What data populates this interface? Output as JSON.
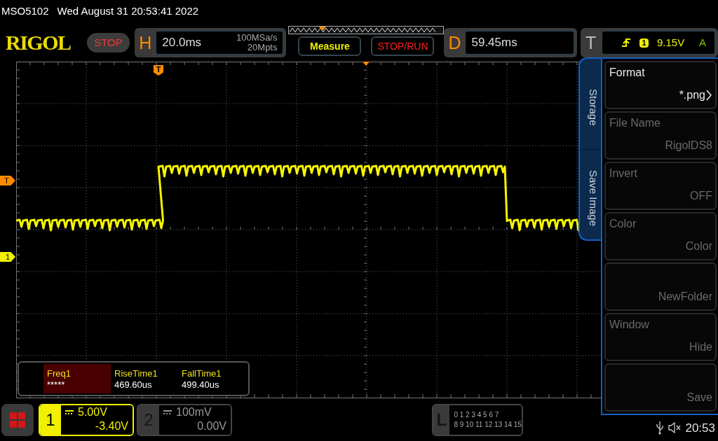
{
  "title_bar": {
    "model": "MSO5102",
    "datetime": "Wed August 31 20:53:41 2022"
  },
  "logo": "RIGOL",
  "run_state": "STOP",
  "horizontal": {
    "label": "H",
    "timebase": "20.0ms",
    "sample_rate": "100MSa/s",
    "memory_depth": "20Mpts"
  },
  "buttons": [
    {
      "label": "Measure",
      "kind": "measure"
    },
    {
      "label": "STOP/RUN",
      "kind": "run"
    }
  ],
  "delay": {
    "label": "D",
    "value": "59.45ms"
  },
  "trigger": {
    "label": "T",
    "source": "1",
    "threshold": "9.15V",
    "mode": "A"
  },
  "grid_markers": {
    "trigger_position": "T",
    "trigger_level": "T",
    "channel": "1"
  },
  "measurements": [
    {
      "name": "Freq1",
      "value": "*****",
      "selected": true
    },
    {
      "name": "RiseTime1",
      "value": "469.60us",
      "selected": false
    },
    {
      "name": "FallTime1",
      "value": "499.40us",
      "selected": false
    }
  ],
  "side_menu": {
    "tabs": [
      "Storage",
      "Save Image"
    ],
    "items": [
      {
        "label": "Format",
        "value": "*.png",
        "disabled": false,
        "submenu": true
      },
      {
        "label": "File Name",
        "value": "RigolDS8",
        "disabled": true,
        "submenu": false
      },
      {
        "label": "Invert",
        "value": "OFF",
        "disabled": true,
        "submenu": false
      },
      {
        "label": "Color",
        "value": "Color",
        "disabled": true,
        "submenu": false
      },
      {
        "value": "NewFolder",
        "disabled": true,
        "submenu": false
      },
      {
        "label": "Window",
        "value": "Hide",
        "disabled": true,
        "submenu": false
      },
      {
        "value": "Save",
        "disabled": true,
        "submenu": false
      }
    ]
  },
  "channels": [
    {
      "number": "1",
      "scale": "5.00V",
      "offset": "-3.40V",
      "active": true
    },
    {
      "number": "2",
      "scale": "100mV",
      "offset": "0.00V",
      "active": false
    }
  ],
  "logic": {
    "label": "L",
    "rows": [
      "0 1 2 3 4 5 6 7",
      "8 9 10 11 12 13 14 15"
    ]
  },
  "status": {
    "clock": "20:53",
    "muted": true
  }
}
